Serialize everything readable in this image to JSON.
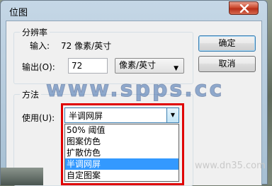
{
  "window": {
    "title": "位图"
  },
  "resolution": {
    "group_label": "分辨率",
    "input_label": "输入:",
    "input_value": "72 像素/英寸",
    "output_label": "输出(O):",
    "output_value": "72",
    "unit_selected": "像素/英寸"
  },
  "method": {
    "group_label": "方法",
    "use_label": "使用(U):",
    "selected": "半调网屏",
    "options": [
      "50% 阈值",
      "图案仿色",
      "扩散仿色",
      "半调网屏",
      "自定图案"
    ],
    "highlighted_index": 3
  },
  "buttons": {
    "ok": "确定",
    "cancel": "取消"
  },
  "watermark": {
    "text": "www.spps.cc",
    "faint_text": "www.dn35.com"
  },
  "colors": {
    "highlight_box": "#e00000",
    "selection": "#3399ff"
  }
}
